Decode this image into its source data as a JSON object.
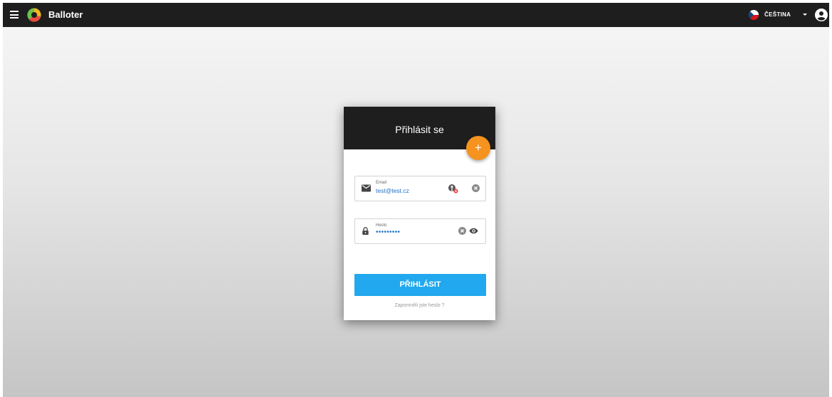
{
  "header": {
    "app_title": "Balloter",
    "language": "ČEŠTINA"
  },
  "login": {
    "title": "Přihlásit se",
    "fab_label": "+",
    "email": {
      "label": "Email",
      "value": "test@test.cz"
    },
    "password": {
      "label": "Heslo",
      "value": "•••••••••"
    },
    "submit_label": "PŘIHLÁSIT",
    "forgot_label": "Zapomněli jste heslo ?"
  },
  "colors": {
    "topbar": "#1e1e1e",
    "accent_orange": "#f6921e",
    "button_blue": "#21a8ee",
    "input_text": "#1e73c8"
  },
  "icons": [
    "menu-icon",
    "app-logo",
    "czech-flag-icon",
    "chevron-down-icon",
    "account-circle-icon",
    "mail-icon",
    "password-manager-key-icon",
    "clear-icon",
    "lock-icon",
    "eye-icon"
  ]
}
